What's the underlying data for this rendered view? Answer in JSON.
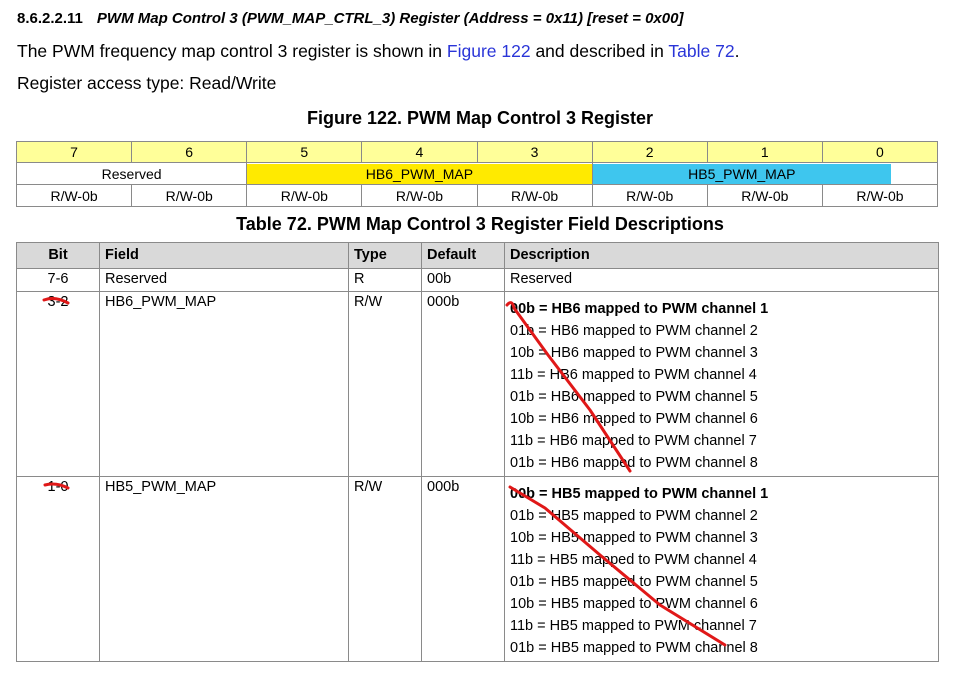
{
  "section": {
    "number": "8.6.2.2.11",
    "title": "PWM Map Control 3 (PWM_MAP_CTRL_3) Register (Address = 0x11) [reset = 0x00]"
  },
  "intro": {
    "before": "The PWM frequency map control 3 register is shown in ",
    "figure_link": "Figure 122",
    "middle": " and described in ",
    "table_link": "Table 72",
    "after": "."
  },
  "access_text": "Register access type: Read/Write",
  "figure_title": "Figure 122.  PWM Map Control 3 Register",
  "register": {
    "bits": [
      "7",
      "6",
      "5",
      "4",
      "3",
      "2",
      "1",
      "0"
    ],
    "fields": [
      {
        "name": "Reserved",
        "span": 2,
        "highlight": "none"
      },
      {
        "name": "HB6_PWM_MAP",
        "span": 3,
        "highlight": "#ffea00"
      },
      {
        "name": "HB5_PWM_MAP",
        "span": 3,
        "highlight": "#3ec6ee"
      }
    ],
    "access": [
      "R/W-0b",
      "R/W-0b",
      "R/W-0b",
      "R/W-0b",
      "R/W-0b",
      "R/W-0b",
      "R/W-0b",
      "R/W-0b"
    ]
  },
  "table_title": "Table 72. PWM Map Control 3 Register Field Descriptions",
  "table": {
    "headers": {
      "bit": "Bit",
      "field": "Field",
      "type": "Type",
      "default": "Default",
      "description": "Description"
    },
    "rows": [
      {
        "bit": "7-6",
        "field": "Reserved",
        "type": "R",
        "default": "00b",
        "description": [
          "Reserved"
        ]
      },
      {
        "bit": "3-2",
        "field": "HB6_PWM_MAP",
        "type": "R/W",
        "default": "000b",
        "description": [
          "00b = HB6 mapped to PWM channel 1",
          "01b = HB6 mapped to PWM channel 2",
          "10b = HB6 mapped to PWM channel 3",
          "11b = HB6 mapped to PWM channel 4",
          "01b = HB6 mapped to PWM channel 5",
          "10b = HB6 mapped to PWM channel 6",
          "11b = HB6 mapped to PWM channel 7",
          "01b = HB6 mapped to PWM channel 8"
        ]
      },
      {
        "bit": "1-0",
        "field": "HB5_PWM_MAP",
        "type": "R/W",
        "default": "000b",
        "description": [
          "00b = HB5 mapped to PWM channel 1",
          "01b = HB5 mapped to PWM channel 2",
          "10b = HB5 mapped to PWM channel 3",
          "11b = HB5 mapped to PWM channel 4",
          "01b = HB5 mapped to PWM channel 5",
          "10b = HB5 mapped to PWM channel 6",
          "11b = HB5 mapped to PWM channel 7",
          "01b = HB5 mapped to PWM channel 8"
        ]
      }
    ]
  },
  "annotation_color": "#e01818"
}
